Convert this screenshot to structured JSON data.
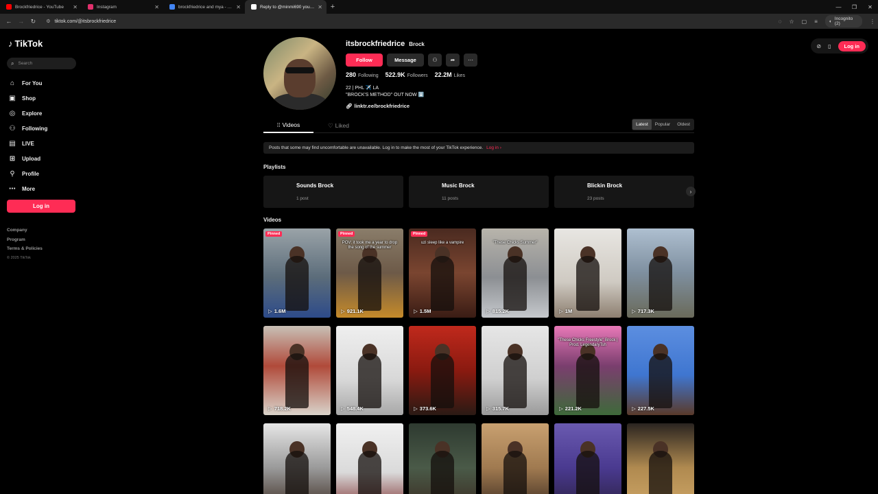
{
  "browser": {
    "tabs": [
      {
        "title": "Brockfriedrice - YouTube",
        "fav": "#ff0000",
        "active": false
      },
      {
        "title": "Instagram",
        "fav": "#e1306c",
        "active": false
      },
      {
        "title": "brockfriedrice and mya - Google",
        "fav": "#4285f4",
        "active": false
      },
      {
        "title": "Reply to @minmi690 you see t",
        "fav": "#ffffff",
        "active": true
      }
    ],
    "new_tab_icon": "plus-icon",
    "url": "tiktok.com/@itsbrockfriedrice",
    "incognito_label": "Incognito (2)"
  },
  "sidebar": {
    "logo_text": "TikTok",
    "search_placeholder": "Search",
    "nav": [
      {
        "label": "For You",
        "icon": "home-icon",
        "glyph": "⌂"
      },
      {
        "label": "Shop",
        "icon": "bag-icon",
        "glyph": "▣"
      },
      {
        "label": "Explore",
        "icon": "compass-icon",
        "glyph": "◎"
      },
      {
        "label": "Following",
        "icon": "user-icon",
        "glyph": "⚇"
      },
      {
        "label": "LIVE",
        "icon": "live-icon",
        "glyph": "▤"
      },
      {
        "label": "Upload",
        "icon": "plus-box-icon",
        "glyph": "⊞"
      },
      {
        "label": "Profile",
        "icon": "person-icon",
        "glyph": "⚲"
      },
      {
        "label": "More",
        "icon": "more-icon",
        "glyph": "⋯"
      }
    ],
    "login_label": "Log in",
    "footer": {
      "company": "Company",
      "program": "Program",
      "terms": "Terms & Policies",
      "copyright": "© 2025 TikTok"
    }
  },
  "header_actions": {
    "login_label": "Log in"
  },
  "profile": {
    "handle": "itsbrockfriedrice",
    "name": "Brock",
    "follow_label": "Follow",
    "message_label": "Message",
    "following_count": "280",
    "following_label": "Following",
    "followers_count": "522.9K",
    "followers_label": "Followers",
    "likes_count": "22.2M",
    "likes_label": "Likes",
    "bio_line1": "22 | PHL ✈️ LA",
    "bio_line2": "\"BROCK'S METHOD\" OUT NOW ⬇️",
    "link": "linktr.ee/brockfriedrice"
  },
  "tabs": {
    "videos": "Videos",
    "liked": "Liked"
  },
  "sort": {
    "latest": "Latest",
    "popular": "Popular",
    "oldest": "Oldest"
  },
  "notice": {
    "text": "Posts that some may find uncomfortable are unavailable. Log in to make the most of your TikTok experience.",
    "link": "Log in"
  },
  "playlists_title": "Playlists",
  "playlists": [
    {
      "title": "Sounds Brock",
      "count": "1 post"
    },
    {
      "title": "Music Brock",
      "count": "11 posts"
    },
    {
      "title": "Blickin Brock",
      "count": "23 posts"
    }
  ],
  "videos_title": "Videos",
  "videos": [
    {
      "views": "1.6M",
      "pinned": "Pinned",
      "caption": "",
      "bg": "linear-gradient(180deg,#9aa3a8,#5b6c7a 55%,#2d4b8a)"
    },
    {
      "views": "921.1K",
      "pinned": "Pinned",
      "caption": "POV: it took me a year to drop the song of the summer",
      "bg": "linear-gradient(180deg,#8a7d6a,#6d5a48 50%,#c58a2a)"
    },
    {
      "views": "1.5M",
      "pinned": "Pinned",
      "caption": "uzi sleep like a vampire",
      "bg": "linear-gradient(180deg,#4a2a20,#7a4530 50%,#3a1c14)"
    },
    {
      "views": "815.2K",
      "pinned": "",
      "caption": "\"These Chicks Summer\"",
      "bg": "linear-gradient(180deg,#b8b4ab,#8c8f93 55%,#c5c8cc)"
    },
    {
      "views": "1M",
      "pinned": "",
      "caption": "",
      "bg": "linear-gradient(180deg,#e8e6e2,#cfcac2 60%,#8d7f70)"
    },
    {
      "views": "717.3K",
      "pinned": "",
      "caption": "",
      "bg": "linear-gradient(180deg,#aebfd0,#7e8f9f 50%,#6a6a5a)"
    },
    {
      "views": "718.2K",
      "pinned": "",
      "caption": "",
      "bg": "linear-gradient(180deg,#c8c0b6,#b04a3a 45%,#d9d3ca)"
    },
    {
      "views": "548.4K",
      "pinned": "",
      "caption": "",
      "bg": "linear-gradient(180deg,#efefef,#d8d8d8 60%,#a8a8a8)"
    },
    {
      "views": "373.6K",
      "pinned": "",
      "caption": "",
      "bg": "linear-gradient(180deg,#c0291c,#8a1a10 50%,#2a1a14)"
    },
    {
      "views": "315.7K",
      "pinned": "",
      "caption": "",
      "bg": "linear-gradient(180deg,#e6e6e6,#cfcfcf 60%,#9a9a9a)"
    },
    {
      "views": "221.2K",
      "pinned": "",
      "caption": "\"These Chicks Freestyle\" Brock | Prod. LegendaryTsh",
      "bg": "linear-gradient(180deg,#e879b8,#7a3e6e 45%,#3e6a3a)"
    },
    {
      "views": "227.5K",
      "pinned": "",
      "caption": "",
      "bg": "linear-gradient(180deg,#5c8ee0,#3f76d0 55%,#5a3a2a)"
    },
    {
      "views": "",
      "pinned": "",
      "caption": "",
      "bg": "linear-gradient(180deg,#e6e6e6,#9a9a9a 50%,#3a2a20)"
    },
    {
      "views": "",
      "pinned": "",
      "caption": "",
      "bg": "linear-gradient(180deg,#f0f0f0,#dadada 55%,#7a2a2a)"
    },
    {
      "views": "",
      "pinned": "",
      "caption": "",
      "bg": "linear-gradient(180deg,#2e3a30,#4a5a48 50%,#3a2a20)"
    },
    {
      "views": "",
      "pinned": "",
      "caption": "",
      "bg": "linear-gradient(180deg,#c8a070,#a07a50 50%,#3a2a20)"
    },
    {
      "views": "",
      "pinned": "",
      "caption": "",
      "bg": "linear-gradient(180deg,#6a5ab0,#4a3a90 50%,#2a2040)"
    },
    {
      "views": "",
      "pinned": "",
      "caption": "",
      "bg": "linear-gradient(180deg,#2a2420,#b08a50 50%,#d0a868)"
    }
  ]
}
